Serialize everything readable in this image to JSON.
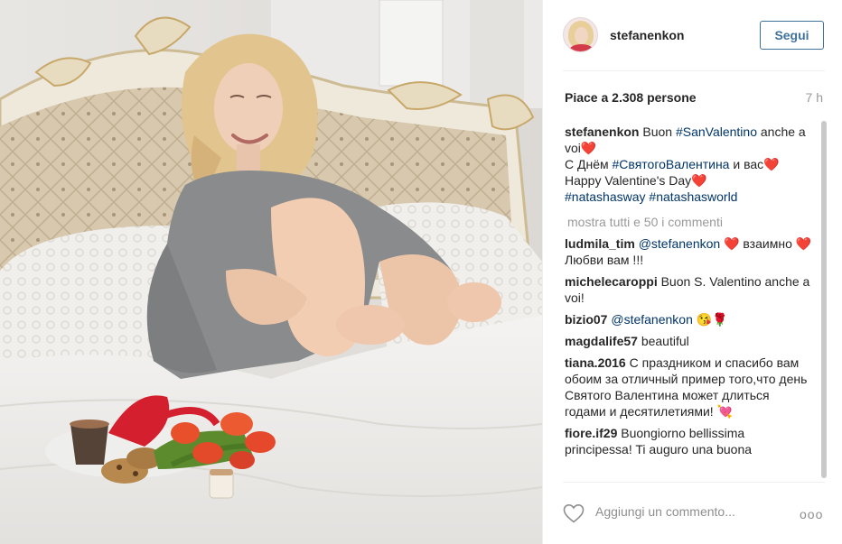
{
  "post": {
    "username": "stefanenkon",
    "follow_label": "Segui",
    "likes": "Piace a 2.308 persone",
    "time": "7 h",
    "caption": {
      "user": "stefanenkon",
      "line1_text": " Buon ",
      "line1_tag": "#SanValentino",
      "line1_end": " anche a voi",
      "line2_text": "С Днём ",
      "line2_tag": "#СвятогоВалентина",
      "line2_end": " и вас",
      "line3": "Happy Valentine's Day",
      "tag_a": "#natashasway",
      "tag_b": "#natashasworld"
    },
    "show_all_label": "mostra tutti e 50 i commenti",
    "comments": [
      {
        "user": "ludmila_tim",
        "mention": "@stefanenkon",
        "text_a": " взаимно ",
        "text_b": "Любви вам !!!"
      },
      {
        "user": "michelecaroppi",
        "text": " Buon S. Valentino anche a voi!"
      },
      {
        "user": "bizio07",
        "mention": "@stefanenkon",
        "text": " 😘🌹"
      },
      {
        "user": "magdalife57",
        "text": " beautiful"
      },
      {
        "user": "tiana.2016",
        "text": " С праздником и спасибо вам обоим за отличный пример того,что день Святого Валентина может длиться годами и десятилетиями! 💘"
      },
      {
        "user": "fiore.if29",
        "text": " Buongiorno bellissima principessa! Ti auguro una buona"
      }
    ],
    "add_comment_placeholder": "Aggiungi un commento...",
    "more_label": "ooo"
  },
  "icons": {
    "heart": "heart-outline-icon",
    "more": "ellipsis-icon",
    "emoji_heart": "❤️"
  },
  "colors": {
    "follow": "#3f729b",
    "link": "#003569",
    "muted": "#999999"
  }
}
